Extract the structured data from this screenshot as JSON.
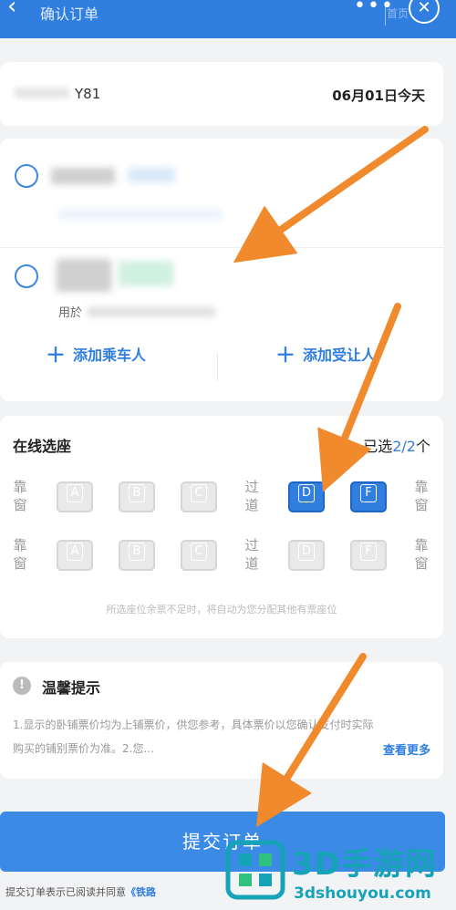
{
  "header": {
    "back_icon": "chevron-left-icon",
    "title": "确认订单",
    "shelter_text": "首页"
  },
  "train": {
    "number_suffix": "Y81",
    "date": "06月01日今天"
  },
  "passengers": {
    "p2_subtext": "用於",
    "add_passenger": "添加乘车人",
    "add_beneficiary": "添加受让人"
  },
  "seat_selection": {
    "title": "在线选座",
    "selected_prefix": "已选",
    "selected_num": "2/2",
    "selected_suffix": "个",
    "window_label": "靠窗",
    "aisle_label": "过道",
    "rows": [
      [
        {
          "label": "A",
          "selected": false
        },
        {
          "label": "B",
          "selected": false
        },
        {
          "label": "C",
          "selected": false
        },
        {
          "label": "D",
          "selected": true
        },
        {
          "label": "F",
          "selected": true
        }
      ],
      [
        {
          "label": "A",
          "selected": false
        },
        {
          "label": "B",
          "selected": false
        },
        {
          "label": "C",
          "selected": false
        },
        {
          "label": "D",
          "selected": false
        },
        {
          "label": "F",
          "selected": false
        }
      ]
    ],
    "note": "所选座位余票不足时，将自动为您分配其他有票座位"
  },
  "tips": {
    "title": "温馨提示",
    "body": "1.显示的卧铺票价均为上铺票价，供您参考，具体票价以您确认支付时实际购买的铺别票价为准。2.您...",
    "more": "查看更多"
  },
  "submit": {
    "label": "提交订单"
  },
  "agreement": {
    "prefix": "提交订单表示已阅读并同意",
    "link": "《铁路"
  },
  "watermark": {
    "name": "3D手游网",
    "url": "3dshouyou.com"
  },
  "colors": {
    "accent": "#2f7ee0",
    "arrow": "#f08a2c",
    "watermark": "#17a3b7"
  }
}
